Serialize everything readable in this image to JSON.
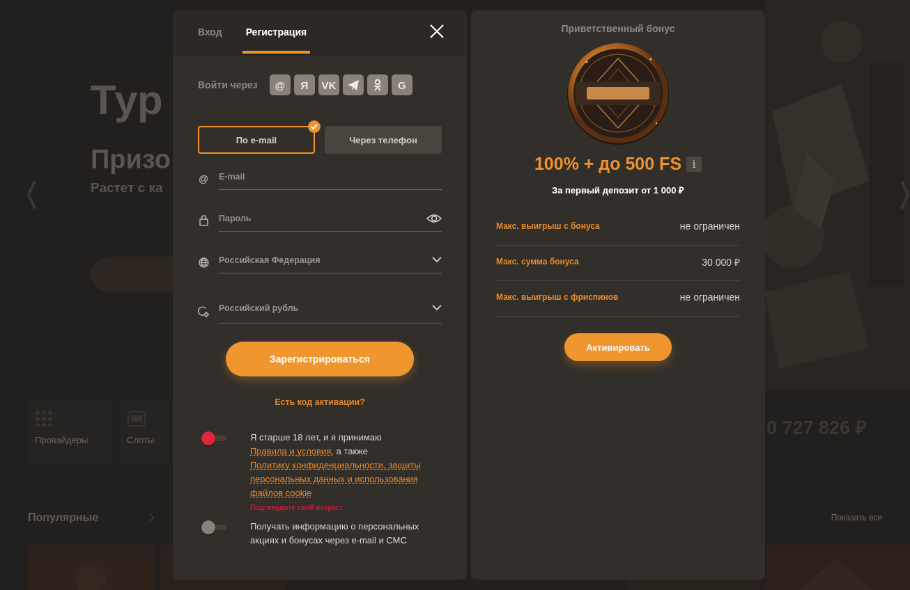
{
  "background": {
    "heading": "Тур",
    "subheading": "Призо",
    "caption": "Растет с ка",
    "tiles": [
      {
        "label": "Провайдеры",
        "kind": "grid"
      },
      {
        "label": "Слоты",
        "kind": "slot"
      }
    ],
    "jackpot": "0 727 826 ₽",
    "section_title": "Популярные",
    "show_all": "Показать все"
  },
  "tabs": [
    {
      "label": "Вход",
      "selected": false
    },
    {
      "label": "Регистрация",
      "selected": true
    }
  ],
  "social": {
    "label": "Войти через",
    "providers": [
      {
        "kind": "glyph",
        "text": "@"
      },
      {
        "kind": "glyph",
        "text": "Я"
      },
      {
        "kind": "glyph",
        "text": "VK"
      },
      {
        "kind": "plane"
      },
      {
        "kind": "person"
      },
      {
        "kind": "glyph",
        "text": "G"
      }
    ]
  },
  "methods": [
    {
      "label": "По e-mail",
      "selected": true
    },
    {
      "label": "Через телефон",
      "selected": false
    }
  ],
  "fields": [
    {
      "kind": "email",
      "symbol": "@",
      "placeholder": "E-mail"
    },
    {
      "kind": "password",
      "placeholder": "Пароль"
    },
    {
      "kind": "country",
      "value": "Российская Федерация"
    },
    {
      "kind": "currency",
      "value": "Российский рубль"
    }
  ],
  "submit": "Зарегистрироваться",
  "activation_link": "Есть код активации?",
  "consents": [
    {
      "on": false,
      "invalid": true,
      "parts": [
        {
          "text": "Я старше 18 лет, и я принимаю "
        },
        {
          "text": "Правила и условия,",
          "link": true
        },
        {
          "text": " а также "
        },
        {
          "text": "Политику конфиденциальности, защиты",
          "link": true
        },
        {
          "text": "персональных данных и использования",
          "link": true
        },
        {
          "text": "файлов cookie",
          "link": true
        }
      ],
      "error": "Подтвердите свой возраст"
    },
    {
      "on": false,
      "invalid": false,
      "parts": [
        {
          "text": "Получать информацию о персональных акциях и бонусах через e-mail и СМС"
        }
      ]
    }
  ],
  "bonus": {
    "title": "Приветственный бонус",
    "offer": "100% + до 500 FS",
    "info": "i",
    "condition": "За первый депозит от 1 000 ₽",
    "terms": [
      {
        "label": "Макс. выигрыш с бонуса",
        "value": "не ограничен"
      },
      {
        "label": "Макс. сумма бонуса",
        "value": "30 000 ₽"
      },
      {
        "label": "Макс. выигрыш с фриспинов",
        "value": "не ограничен"
      }
    ],
    "button": "Активировать"
  }
}
